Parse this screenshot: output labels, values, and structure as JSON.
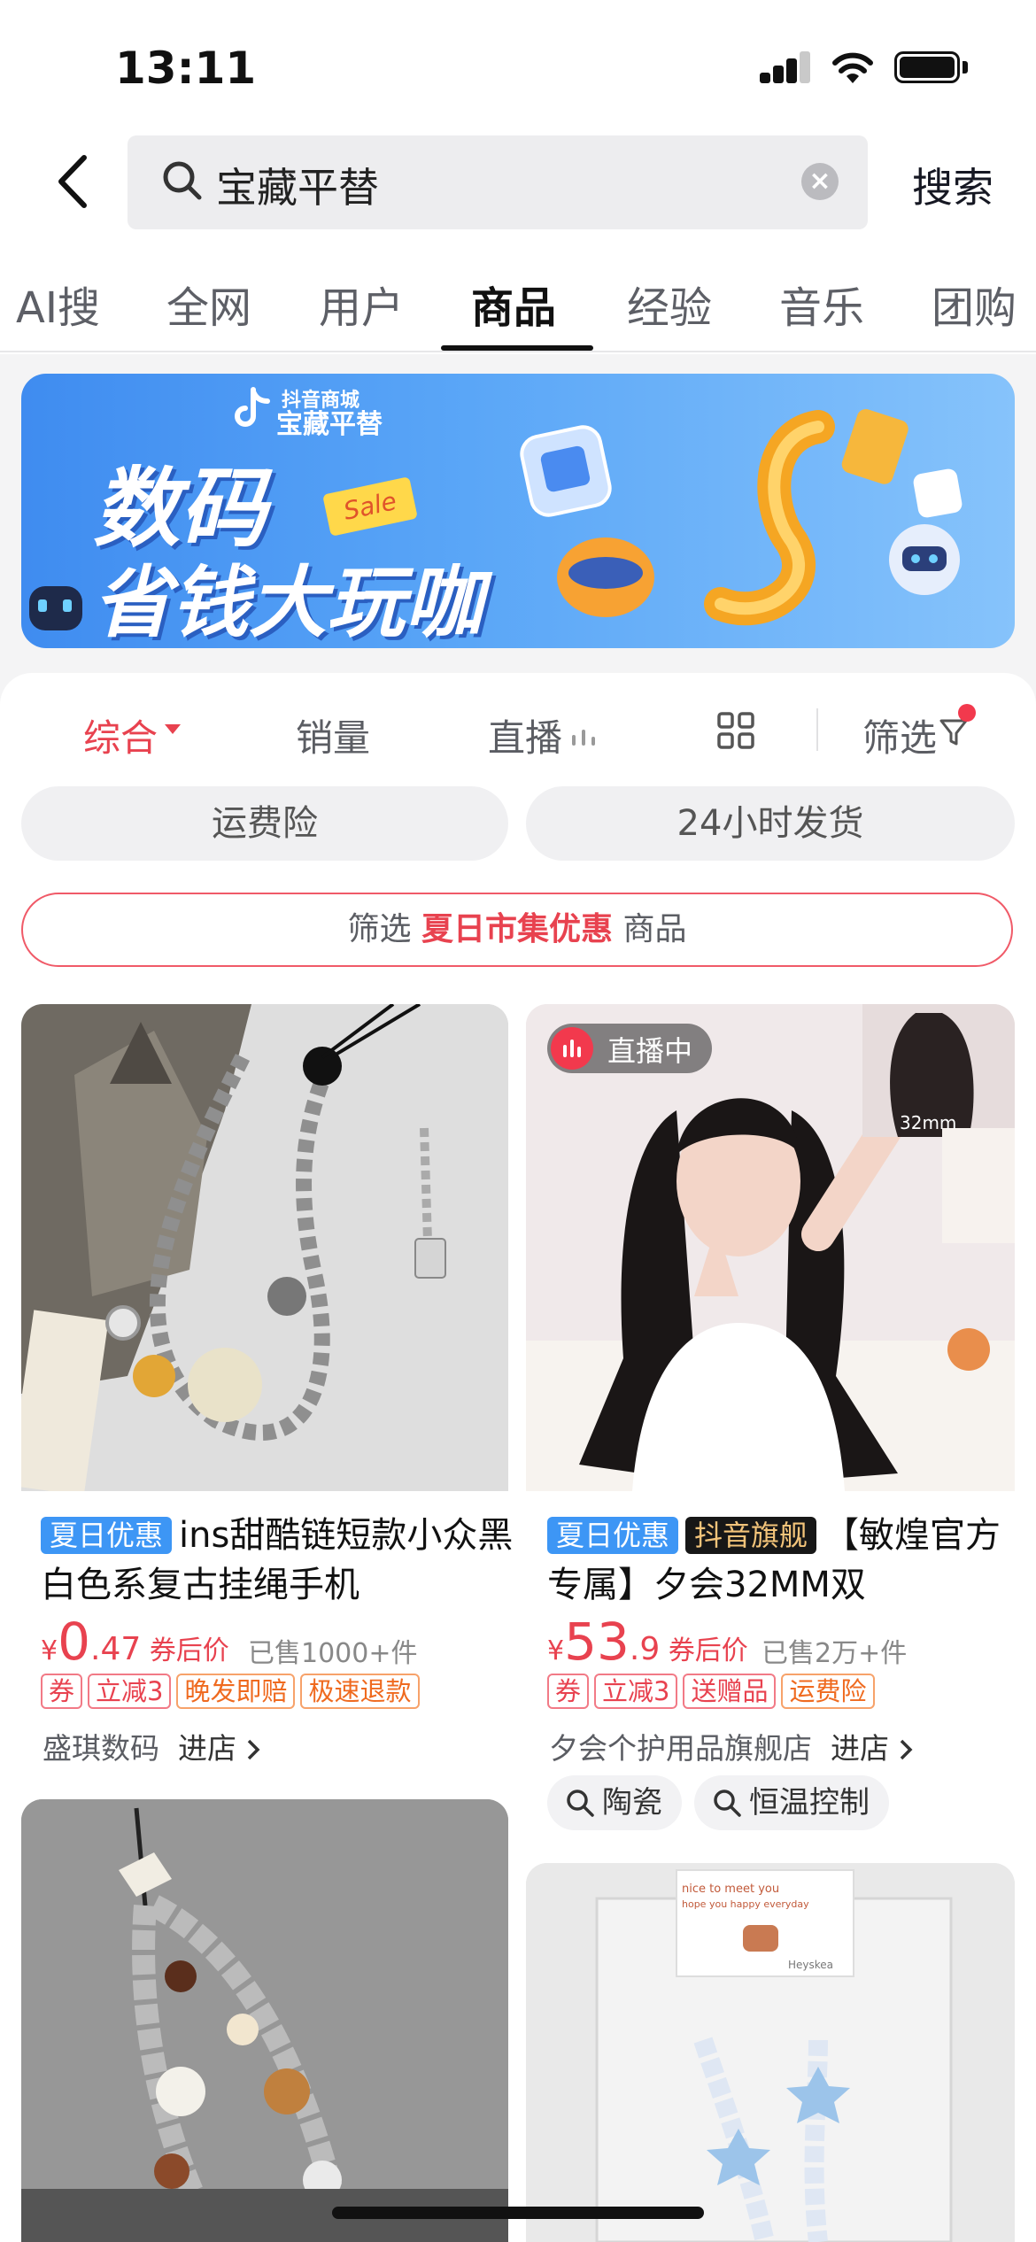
{
  "status_bar": {
    "time": "13:11"
  },
  "search": {
    "query": "宝藏平替",
    "button": "搜索"
  },
  "tabs": [
    "AI搜",
    "全网",
    "用户",
    "商品",
    "经验",
    "音乐",
    "团购"
  ],
  "active_tab": "商品",
  "banner": {
    "logo_line1": "抖音商城",
    "logo_line2": "宝藏平替",
    "title1": "数码",
    "title2": "省钱大玩咖",
    "tag": "Sale"
  },
  "sort": {
    "comprehensive": "综合",
    "sales": "销量",
    "live": "直播",
    "filter": "筛选"
  },
  "chips": [
    "运费险",
    "24小时发货"
  ],
  "promo": {
    "prefix": "筛选",
    "highlight": "夏日市集优惠",
    "suffix": "商品"
  },
  "products": [
    {
      "badges": [
        "夏日优惠"
      ],
      "title": "ins甜酷链短款小众黑白色系复古挂绳手机",
      "price_symbol": "¥",
      "price_int": "0",
      "price_dec": ".47",
      "price_note": "券后价",
      "sold": "已售1000+件",
      "tags": [
        "券",
        "立减3",
        "晚发即赔",
        "极速退款"
      ],
      "shop": "盛琪数码",
      "enter": "进店"
    },
    {
      "badges": [
        "夏日优惠",
        "抖音旗舰"
      ],
      "title": "【敏煌官方专属】夕会32MM双",
      "price_symbol": "¥",
      "price_int": "53",
      "price_dec": ".9",
      "price_note": "券后价",
      "sold": "已售2万+件",
      "tags": [
        "券",
        "立减3",
        "送赠品",
        "运费险"
      ],
      "shop": "夕会个护用品旗舰店",
      "enter": "进店",
      "live": "直播中",
      "thumb_label": "32mm",
      "keywords": [
        "陶瓷",
        "恒温控制"
      ]
    }
  ],
  "photo_card": {
    "caption": "nice to meet you",
    "sub": "hope you happy everyday",
    "sign": "Heyskea"
  },
  "colors": {
    "accent": "#e8424f",
    "blue_badge": "#3d96f5",
    "banner": "#4a96f2"
  }
}
